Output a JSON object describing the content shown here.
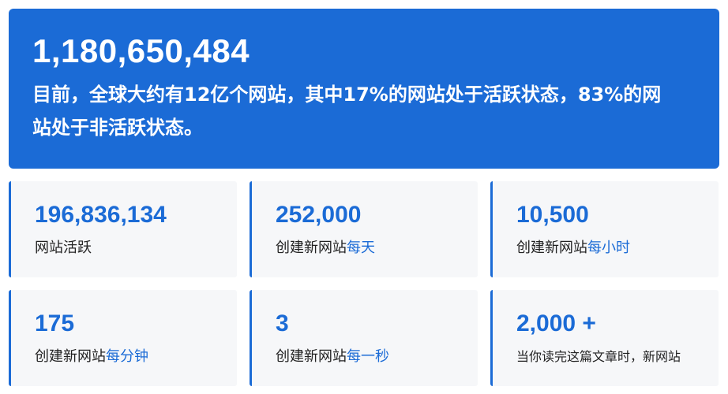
{
  "hero": {
    "number": "1,180,650,484",
    "description": "目前，全球大约有12亿个网站，其中17%的网站处于活跃状态，83%的网站处于非活跃状态。"
  },
  "cards": [
    {
      "number": "196,836,134",
      "label": "网站活跃",
      "accent": ""
    },
    {
      "number": "252,000",
      "label": "创建新网站",
      "accent": "每天"
    },
    {
      "number": "10,500",
      "label": "创建新网站",
      "accent": "每小时"
    },
    {
      "number": "175",
      "label": "创建新网站",
      "accent": "每分钟"
    },
    {
      "number": "3",
      "label": "创建新网站",
      "accent": "每一秒"
    },
    {
      "number": "2,000 +",
      "label": "当你读完这篇文章时，新网站",
      "accent": ""
    }
  ],
  "colors": {
    "accent": "#1b6bd6",
    "card_bg": "#f6f7f9",
    "hero_bg": "#1b6bd6"
  }
}
